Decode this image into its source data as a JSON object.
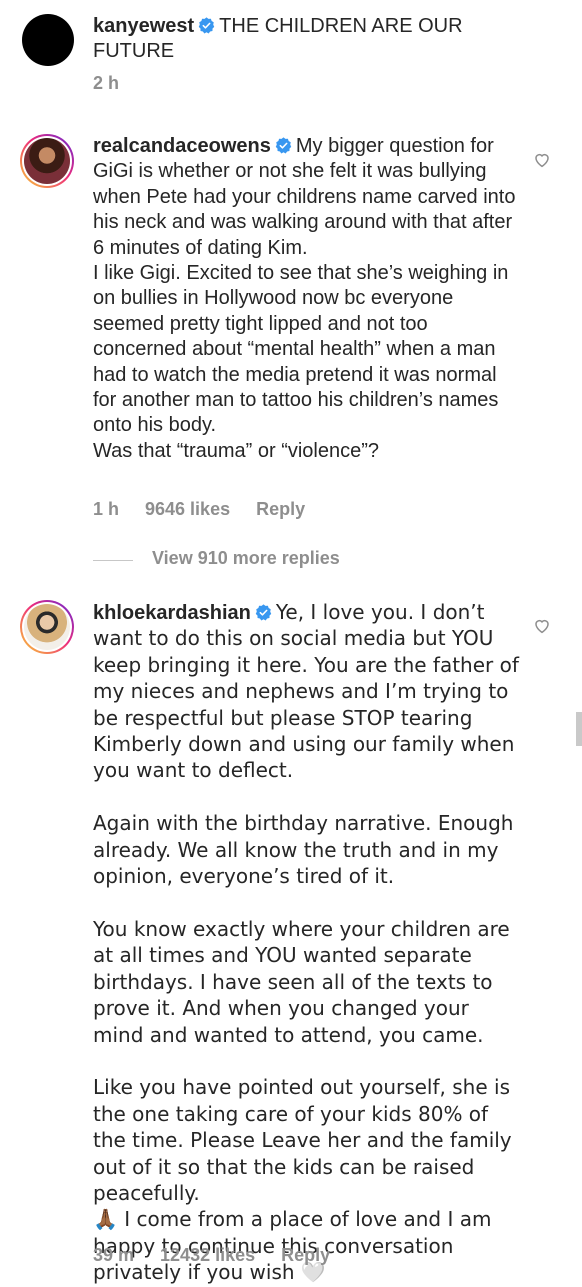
{
  "post": {
    "username": "kanyewest",
    "caption": "THE CHILDREN ARE OUR FUTURE",
    "time": "2 h"
  },
  "comments": [
    {
      "username": "realcandaceowens",
      "text_first": "My bigger question for GiGi is whether or not she felt it was bullying when Pete had your childrens name carved into his neck and was walking around with that after 6 minutes of dating Kim.\nI like Gigi. Excited to see that she’s weighing in on bullies in Hollywood now bc everyone seemed pretty tight lipped and not too concerned about “mental health” when a man had to watch the media pretend it was normal for another man to tattoo his children’s names onto his body.\nWas that “trauma” or “violence”?",
      "time": "1 h",
      "likes": "9646 likes",
      "reply": "Reply"
    },
    {
      "username": "khloekardashian",
      "text_first": "Ye, I love you. I don’t want to do this on social media but YOU keep bringing it here. You are the father of my nieces and nephews and I’m trying to be respectful but please STOP tearing Kimberly down and using our family when you want to deflect.\n\nAgain with the birthday narrative. Enough already. We all know the truth and in my opinion, everyone’s tired of it.\n\nYou know exactly where your children are at all times and YOU wanted separate birthdays. I have seen all of the texts to prove it. And when you changed your mind and wanted to attend, you came.\n\nLike you have pointed out yourself, she is the one taking care of your kids 80% of the time. Please Leave her and the family out of it so that the kids can be raised peacefully.\n🙏🏾 I come from a place of love and I am happy to continue this conversation privately if you wish 🤍",
      "time": "39 m",
      "likes": "12432 likes",
      "reply": "Reply"
    }
  ],
  "view_more_replies": "View 910 more replies",
  "icons": {
    "verified": "verified-badge-icon",
    "heart": "heart-outline-icon",
    "accent_blue": "#3897f0"
  }
}
